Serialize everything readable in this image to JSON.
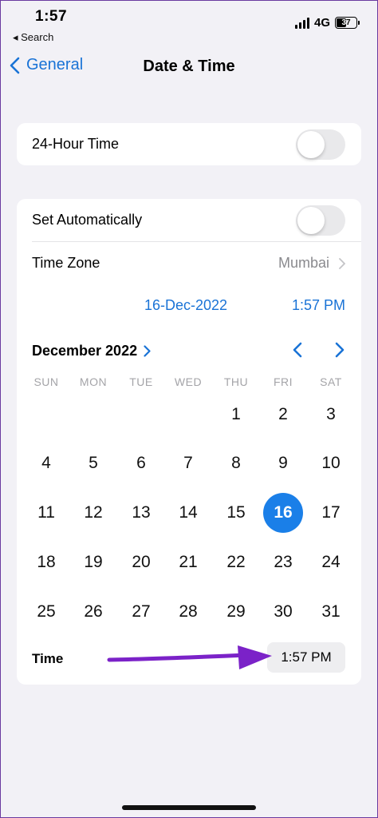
{
  "status": {
    "time": "1:57",
    "back_app": "◂ Search",
    "network": "4G",
    "battery": "37"
  },
  "nav": {
    "back_label": "General",
    "title": "Date & Time"
  },
  "settings": {
    "hour24_label": "24-Hour Time",
    "hour24_on": false,
    "auto_label": "Set Automatically",
    "auto_on": false,
    "timezone_label": "Time Zone",
    "timezone_value": "Mumbai",
    "date_value": "16-Dec-2022",
    "time_value": "1:57 PM"
  },
  "calendar": {
    "month_label": "December 2022",
    "weekdays": [
      "SUN",
      "MON",
      "TUE",
      "WED",
      "THU",
      "FRI",
      "SAT"
    ],
    "weeks": [
      [
        "",
        "",
        "",
        "",
        "1",
        "2",
        "3"
      ],
      [
        "4",
        "5",
        "6",
        "7",
        "8",
        "9",
        "10"
      ],
      [
        "11",
        "12",
        "13",
        "14",
        "15",
        "16",
        "17"
      ],
      [
        "18",
        "19",
        "20",
        "21",
        "22",
        "23",
        "24"
      ],
      [
        "25",
        "26",
        "27",
        "28",
        "29",
        "30",
        "31"
      ]
    ],
    "selected_day": "16"
  },
  "time_row": {
    "label": "Time",
    "value": "1:57 PM"
  },
  "colors": {
    "accent": "#1a73d6",
    "selected_day_bg": "#1a7fe8",
    "annotation_arrow": "#7b22c8"
  }
}
